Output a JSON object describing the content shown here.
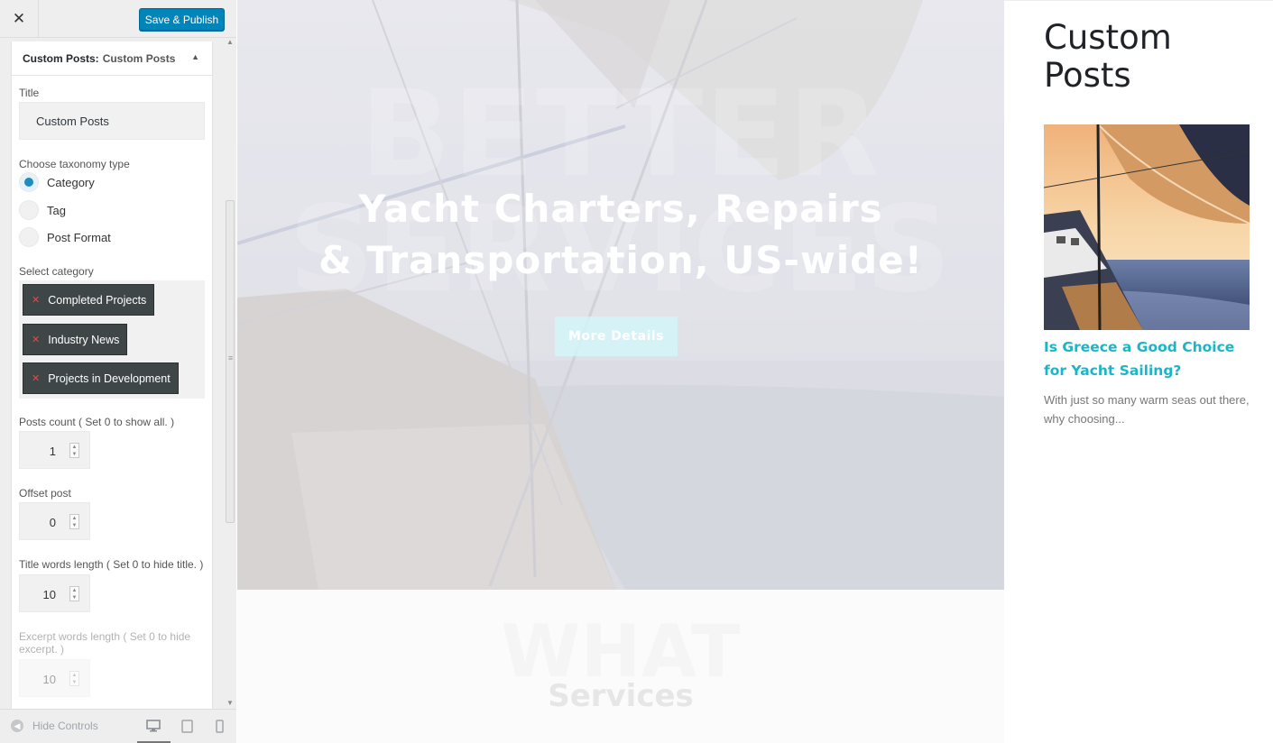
{
  "header": {
    "close_icon": "✕",
    "publish_label": "Save & Publish"
  },
  "widget": {
    "title_prefix": "Custom Posts:",
    "title_name": "Custom Posts",
    "title_label": "Title",
    "title_value": "Custom Posts",
    "taxonomy_label": "Choose taxonomy type",
    "taxonomy_options": [
      "Category",
      "Tag",
      "Post Format"
    ],
    "taxonomy_selected": "Category",
    "category_label": "Select category",
    "categories": [
      "Completed Projects",
      "Industry News",
      "Projects in Development"
    ],
    "posts_count_label": "Posts count ( Set 0 to show all. )",
    "posts_count_value": "1",
    "offset_label": "Offset post",
    "offset_value": "0",
    "title_words_label": "Title words length ( Set 0 to hide title. )",
    "title_words_value": "10",
    "excerpt_words_label": "Excerpt words length ( Set 0 to hide excerpt. )",
    "excerpt_words_value": "10"
  },
  "footer": {
    "hide_controls_label": "Hide Controls"
  },
  "preview": {
    "hero_bg_text_line1": "BETTER",
    "hero_bg_text_line2": "SERVICES",
    "hero_heading_line1": "Yacht Charters, Repairs",
    "hero_heading_line2": "& Transportation, US-wide!",
    "hero_button": "More Details",
    "services_ghost": "WHAT",
    "services_title": "Services"
  },
  "sidebar": {
    "widget_title": "Custom Posts",
    "post_title": "Is Greece a Good Choice for Yacht Sailing?",
    "post_excerpt": "With just so many warm seas out there, why choosing..."
  },
  "colors": {
    "publish_button": "#0085ba",
    "chip_background": "#3f4648",
    "chip_remove": "#e14d43",
    "radio_selected": "#1e8cbe",
    "post_link": "#1ab6c8",
    "hero_button": "#d2f4f8"
  }
}
